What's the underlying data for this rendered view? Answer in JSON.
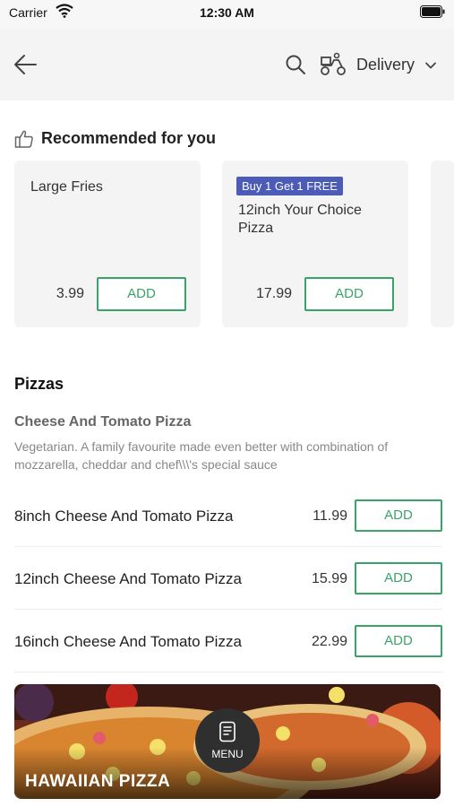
{
  "status_bar": {
    "carrier": "Carrier",
    "time": "12:30 AM"
  },
  "header": {
    "back_icon": "arrow-left-icon",
    "search_icon": "search-icon",
    "mode_icon": "scooter-icon",
    "mode_label": "Delivery"
  },
  "recommended": {
    "title": "Recommended for you",
    "items": [
      {
        "name": "Large Fries",
        "price": "3.99",
        "add_label": "ADD"
      },
      {
        "badge": "Buy 1 Get 1 FREE",
        "name": "12inch Your Choice Pizza",
        "price": "17.99",
        "add_label": "ADD"
      }
    ]
  },
  "pizzas": {
    "title": "Pizzas",
    "group_title": "Cheese And Tomato Pizza",
    "group_description": "Vegetarian. A family favourite made even better with combination of mozzarella, cheddar and chef\\\\\\'s special sauce",
    "items": [
      {
        "name": "8inch Cheese And Tomato Pizza",
        "price": "11.99",
        "add_label": "ADD"
      },
      {
        "name": "12inch Cheese And Tomato Pizza",
        "price": "15.99",
        "add_label": "ADD"
      },
      {
        "name": "16inch Cheese And Tomato Pizza",
        "price": "22.99",
        "add_label": "ADD"
      }
    ]
  },
  "banner": {
    "label": "HAWAIIAN PIZZA"
  },
  "menu_button": {
    "label": "MENU"
  },
  "colors": {
    "accent": "#3aa36a",
    "badge": "#4b5bb7",
    "fab": "#2f2f2f"
  }
}
